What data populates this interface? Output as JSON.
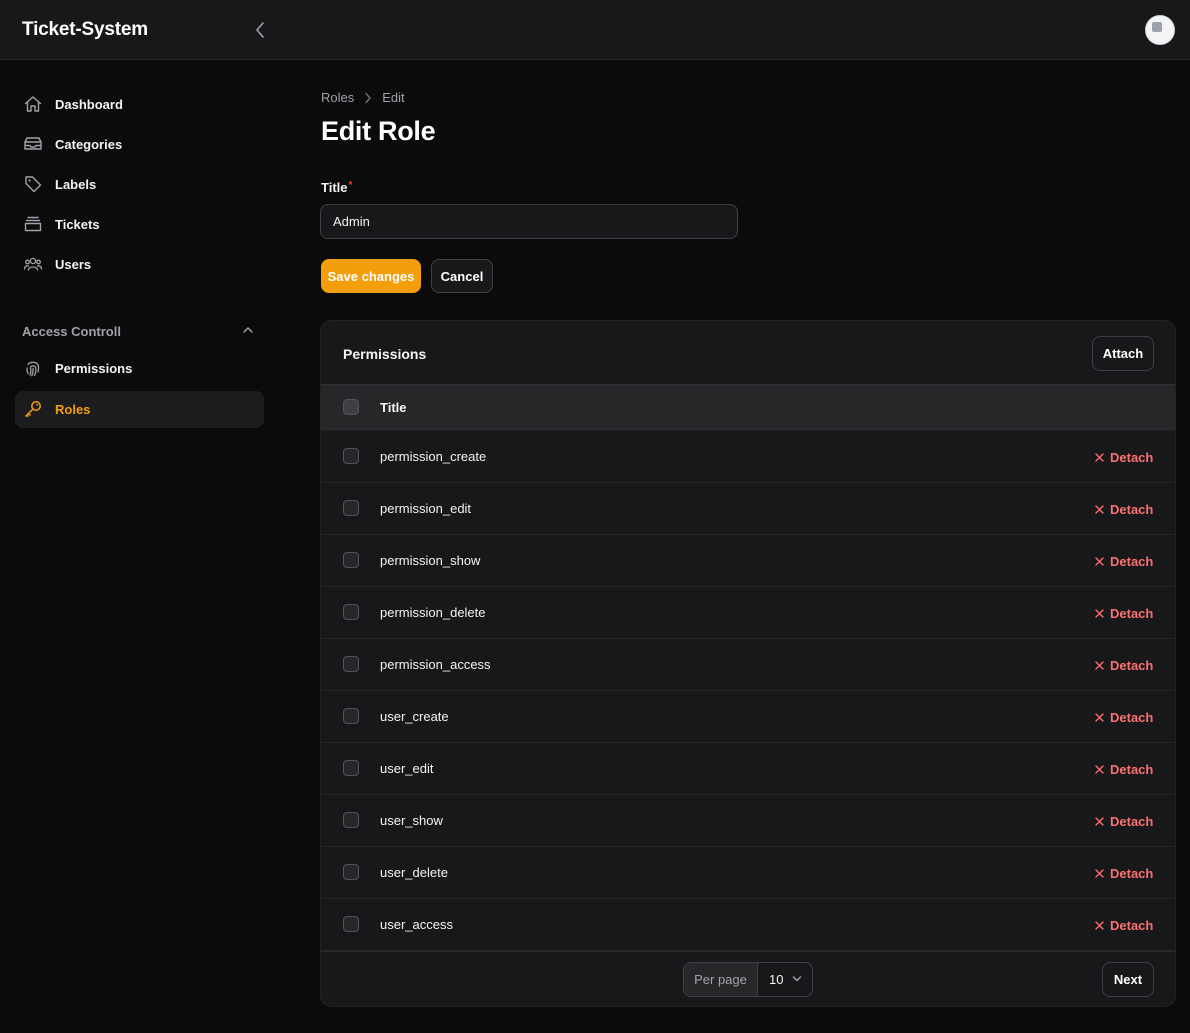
{
  "app": {
    "title": "Ticket-System"
  },
  "sidebar": {
    "items": [
      {
        "label": "Dashboard",
        "icon": "home-icon"
      },
      {
        "label": "Categories",
        "icon": "inbox-stack-icon"
      },
      {
        "label": "Labels",
        "icon": "tag-icon"
      },
      {
        "label": "Tickets",
        "icon": "rectangle-stack-icon"
      },
      {
        "label": "Users",
        "icon": "user-group-icon"
      }
    ],
    "group": {
      "label": "Access Controll",
      "items": [
        {
          "label": "Permissions",
          "icon": "finger-print-icon"
        },
        {
          "label": "Roles",
          "icon": "key-icon",
          "active": true
        }
      ]
    }
  },
  "breadcrumb": {
    "parent": "Roles",
    "current": "Edit"
  },
  "page": {
    "title": "Edit Role"
  },
  "form": {
    "title_label": "Title",
    "required_mark": "*",
    "title_value": "Admin",
    "save_label": "Save changes",
    "cancel_label": "Cancel"
  },
  "permissions": {
    "heading": "Permissions",
    "attach_label": "Attach",
    "column_title": "Title",
    "detach_label": "Detach",
    "rows": [
      "permission_create",
      "permission_edit",
      "permission_show",
      "permission_delete",
      "permission_access",
      "user_create",
      "user_edit",
      "user_show",
      "user_delete",
      "user_access"
    ],
    "per_page_label": "Per page",
    "per_page_value": "10",
    "next_label": "Next"
  },
  "colors": {
    "accent": "#f59e0b",
    "danger": "#f87171",
    "background": "#0b0b0c",
    "surface": "#18181b"
  }
}
